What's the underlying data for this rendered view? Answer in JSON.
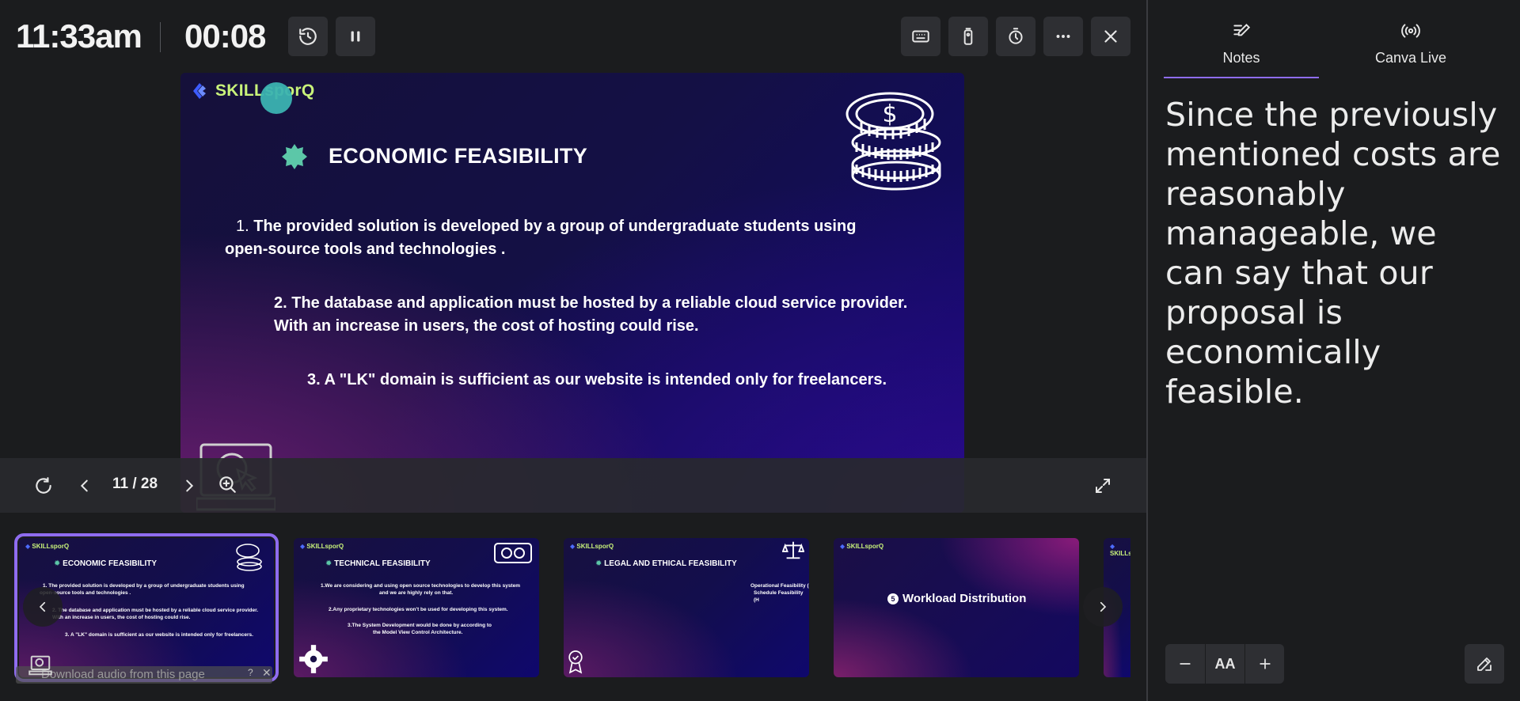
{
  "topbar": {
    "clock": "11:33am",
    "timer": "00:08",
    "icons": [
      "history-icon",
      "pause-icon",
      "keyboard-icon",
      "remote-icon",
      "timer-icon",
      "more-icon",
      "close-icon"
    ]
  },
  "slide": {
    "logo": "SKILLsporQ",
    "title": "ECONOMIC FEASIBILITY",
    "p1_num": "1.",
    "p1_a": "The provided solution is developed by a group of undergraduate students using",
    "p1_b": "open-source tools and technologies .",
    "p2_a": "2. The database and application must be hosted by a reliable cloud service provider.",
    "p2_b": "With an increase in users, the cost of hosting could rise.",
    "p3": "3. A \"LK\" domain is sufficient as our website is intended only for freelancers."
  },
  "controls": {
    "counter": "11 / 28"
  },
  "thumbnails": [
    {
      "logo": "SKILLsporQ",
      "title": "ECONOMIC FEASIBILITY",
      "l1": "1. The provided solution is developed by a group of undergraduate students using",
      "l2": "open-source tools and technologies .",
      "l3": "2. The database and application must be hosted by a reliable cloud service provider.",
      "l4": "With an increase in users, the cost of hosting could rise.",
      "l5": "3. A \"LK\" domain is sufficient as our website is intended only for freelancers."
    },
    {
      "logo": "SKILLsporQ",
      "title": "TECHNICAL FEASIBILITY",
      "l1": "1.We are considering and using open source technologies to develop this system",
      "l2": "and we are highly rely on that.",
      "l3": "2.Any proprietary technologies won't be used for developing this system.",
      "l4": "3.The System Development would be done by according to",
      "l5": "the Model View Control Architecture."
    },
    {
      "logo": "SKILLsporQ",
      "title": "LEGAL AND ETHICAL FEASIBILITY",
      "l1": "Operational Feasibility (",
      "l2": "Schedule Feasibility (H"
    },
    {
      "logo": "SKILLsporQ",
      "title": "Workload Distribution",
      "num": "5"
    },
    {
      "logo": "SKILLs"
    }
  ],
  "download_banner": "Download audio from this page",
  "download_q": "?",
  "download_x": "✕",
  "notes_panel": {
    "tabs": [
      {
        "label": "Notes",
        "icon": "pencil-lines-icon"
      },
      {
        "label": "Canva Live",
        "icon": "broadcast-icon"
      }
    ],
    "text": "Since the previously mentioned costs are reasonably manageable, we can say that our proposal is economically feasible.",
    "zoom_label": "AA"
  },
  "colors": {
    "accent": "#8f6cf0",
    "logo_green": "#c9f37a",
    "cursor_teal": "#3bb3b1"
  }
}
